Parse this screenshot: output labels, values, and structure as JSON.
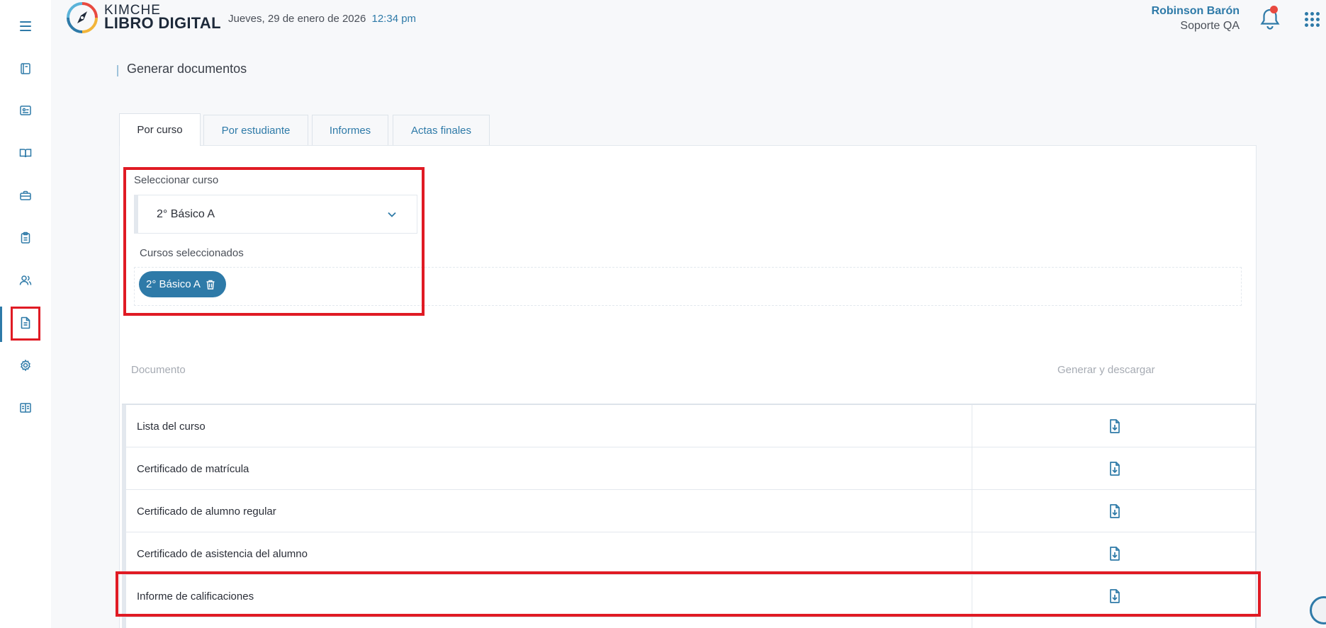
{
  "header": {
    "logo_top": "KIMCHE",
    "logo_bottom": "LIBRO DIGITAL",
    "date": "Jueves, 29 de enero de 2026",
    "time": "12:34 pm",
    "user_name": "Robinson Barón",
    "user_role": "Soporte QA"
  },
  "sidebar": {
    "items": [
      {
        "icon": "notebook-icon"
      },
      {
        "icon": "id-card-icon"
      },
      {
        "icon": "open-book-icon"
      },
      {
        "icon": "briefcase-icon"
      },
      {
        "icon": "clipboard-icon"
      },
      {
        "icon": "users-icon"
      },
      {
        "icon": "document-icon",
        "active": true
      },
      {
        "icon": "gear-icon"
      },
      {
        "icon": "book-reader-icon"
      }
    ]
  },
  "page": {
    "title": "Generar documentos"
  },
  "tabs": [
    {
      "label": "Por curso",
      "active": true
    },
    {
      "label": "Por estudiante"
    },
    {
      "label": "Informes"
    },
    {
      "label": "Actas finales"
    }
  ],
  "course_selector": {
    "label": "Seleccionar curso",
    "value": "2° Básico A",
    "selected_label": "Cursos seleccionados",
    "chips": [
      "2° Básico A"
    ]
  },
  "table": {
    "col_document": "Documento",
    "col_generate": "Generar y descargar",
    "rows": [
      {
        "document": "Lista del curso"
      },
      {
        "document": "Certificado de matrícula"
      },
      {
        "document": "Certificado de alumno regular"
      },
      {
        "document": "Certificado de asistencia del alumno"
      },
      {
        "document": "Informe de calificaciones"
      },
      {
        "document": ""
      }
    ]
  },
  "colors": {
    "accent": "#2e7aa8",
    "highlight": "#e01b24",
    "notification": "#e8493f"
  }
}
